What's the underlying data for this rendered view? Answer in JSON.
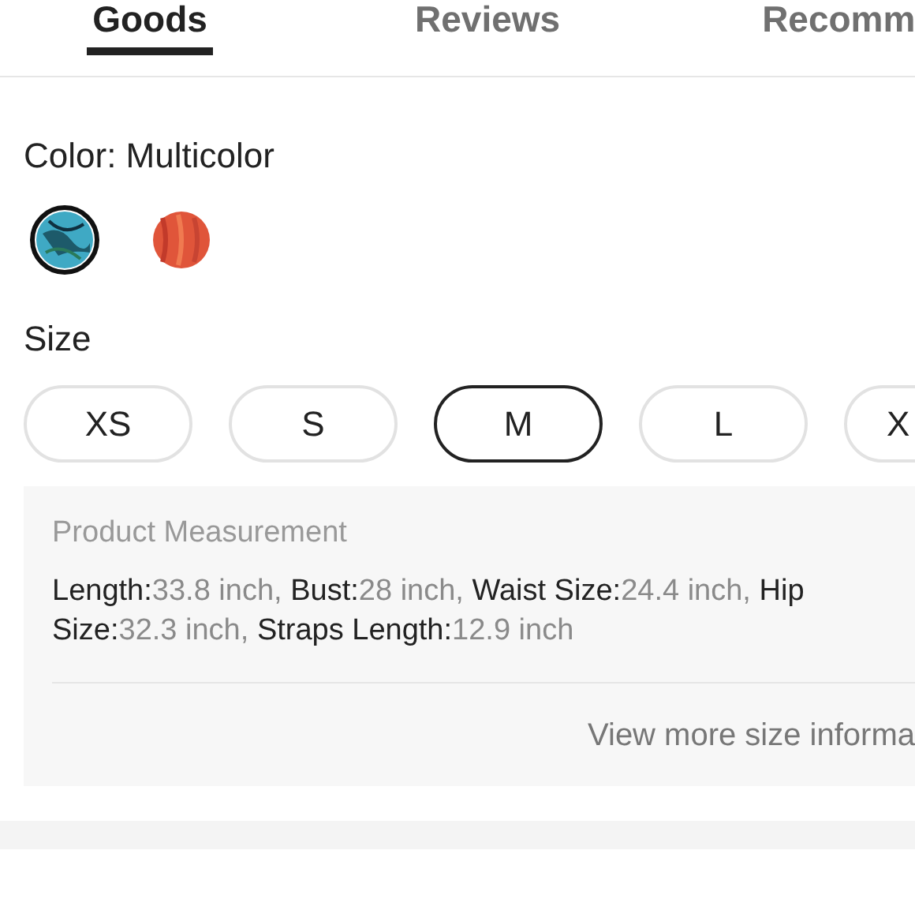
{
  "tabs": [
    {
      "label": "Goods",
      "selected": true
    },
    {
      "label": "Reviews",
      "selected": false
    },
    {
      "label": "Recomm",
      "selected": false
    }
  ],
  "color": {
    "label": "Color: Multicolor",
    "swatches": [
      {
        "kind": "picture",
        "selected": true,
        "color": "#3fa9c4"
      },
      {
        "kind": "picture",
        "selected": false,
        "color": "#e0553a"
      }
    ]
  },
  "size": {
    "label": "Size",
    "options": [
      {
        "label": "XS",
        "selected": false
      },
      {
        "label": "S",
        "selected": false
      },
      {
        "label": "M",
        "selected": true
      },
      {
        "label": "L",
        "selected": false
      },
      {
        "label": "X",
        "selected": false
      }
    ]
  },
  "measurement": {
    "title": "Product Measurement",
    "items": [
      {
        "label": "Length:",
        "value": "33.8 inch,"
      },
      {
        "label": "Bust:",
        "value": "28 inch,"
      },
      {
        "label": "Waist Size:",
        "value": "24.4 inch,"
      },
      {
        "label": "Hip Size:",
        "value": "32.3 inch,"
      },
      {
        "label": "Straps Length:",
        "value": "12.9 inch"
      }
    ],
    "link": "View more size informa"
  }
}
